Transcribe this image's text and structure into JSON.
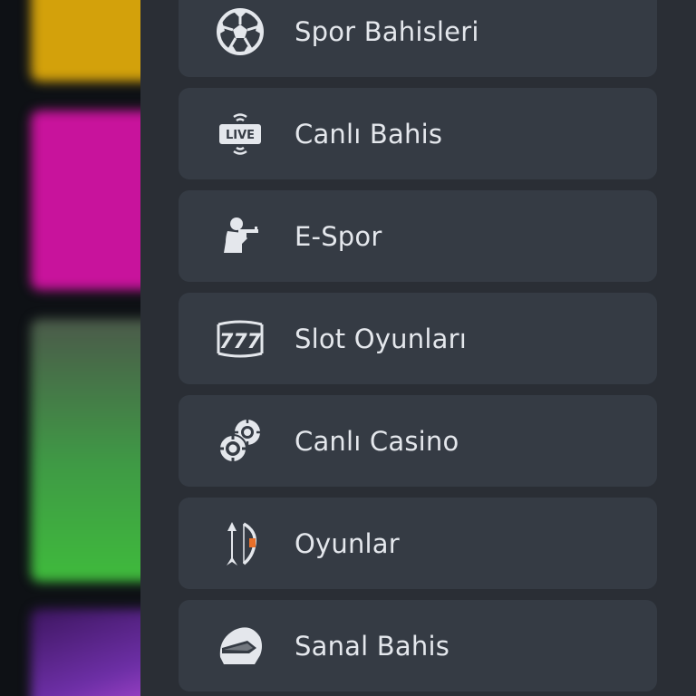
{
  "background": {
    "tiles": [
      {
        "label": "",
        "color": "#d3a10b"
      },
      {
        "label": "",
        "color": "#c8139c"
      },
      {
        "label": "",
        "color": "#3fbb3c"
      },
      {
        "label": "",
        "color": "#6d2fa6"
      }
    ]
  },
  "drawer": {
    "background_color": "#2a2e35",
    "item_color": "#353b44",
    "text_color": "#e4e7ec",
    "items": [
      {
        "label": "Spor Bahisleri",
        "icon": "soccer-ball-icon"
      },
      {
        "label": "Canlı Bahis",
        "icon": "live-tv-icon",
        "icon_text": "LIVE"
      },
      {
        "label": "E-Spor",
        "icon": "esports-soldier-icon"
      },
      {
        "label": "Slot Oyunları",
        "icon": "slot-777-icon",
        "icon_text": "777"
      },
      {
        "label": "Canlı Casino",
        "icon": "casino-chips-icon"
      },
      {
        "label": "Oyunlar",
        "icon": "bow-arrow-icon"
      },
      {
        "label": "Sanal Bahis",
        "icon": "racing-helmet-icon"
      }
    ]
  }
}
